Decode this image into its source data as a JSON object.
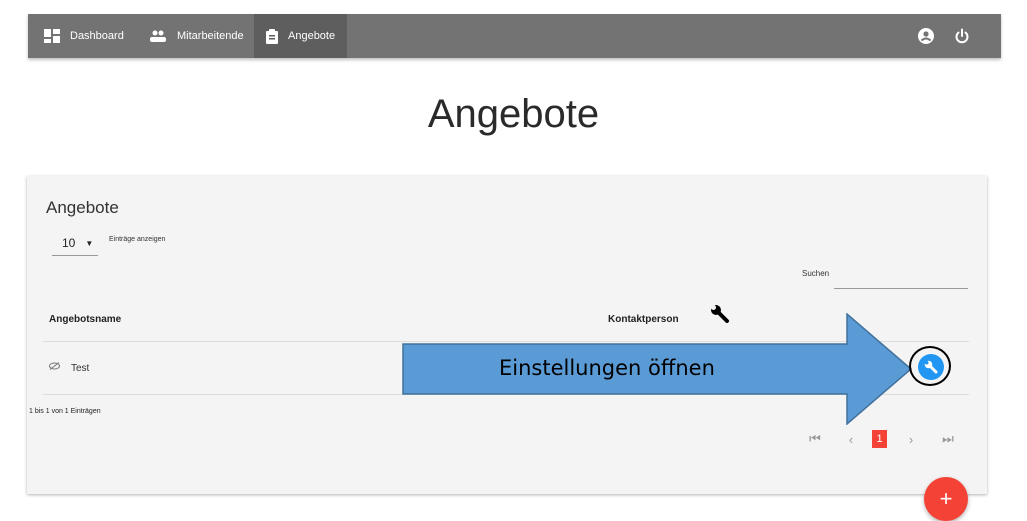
{
  "nav": {
    "items": [
      {
        "label": "Dashboard",
        "icon": "dashboard-icon"
      },
      {
        "label": "Mitarbeitende",
        "icon": "people-icon"
      },
      {
        "label": "Angebote",
        "icon": "clipboard-icon",
        "active": true
      }
    ],
    "right_icons": [
      "account-icon",
      "power-icon"
    ]
  },
  "page": {
    "title": "Angebote"
  },
  "card": {
    "title": "Angebote",
    "length_select": {
      "value": "10",
      "label": "Einträge anzeigen"
    },
    "search": {
      "label": "Suchen",
      "value": ""
    },
    "columns": [
      "Angebotsname",
      "Kontaktperson"
    ],
    "rows": [
      {
        "name": "Test",
        "icon": "eye-off-icon"
      }
    ],
    "info": "1 bis 1 von 1 Einträgen",
    "pagination": {
      "first": "⏮",
      "prev": "‹",
      "current": "1",
      "next": "›",
      "last": "⏭"
    }
  },
  "fab": {
    "label": "+"
  },
  "callout": {
    "text": "Einstellungen öffnen"
  },
  "colors": {
    "topbar": "#737373",
    "accent": "#f44336",
    "callout": "#5b9bd5",
    "action": "#2196f3"
  }
}
